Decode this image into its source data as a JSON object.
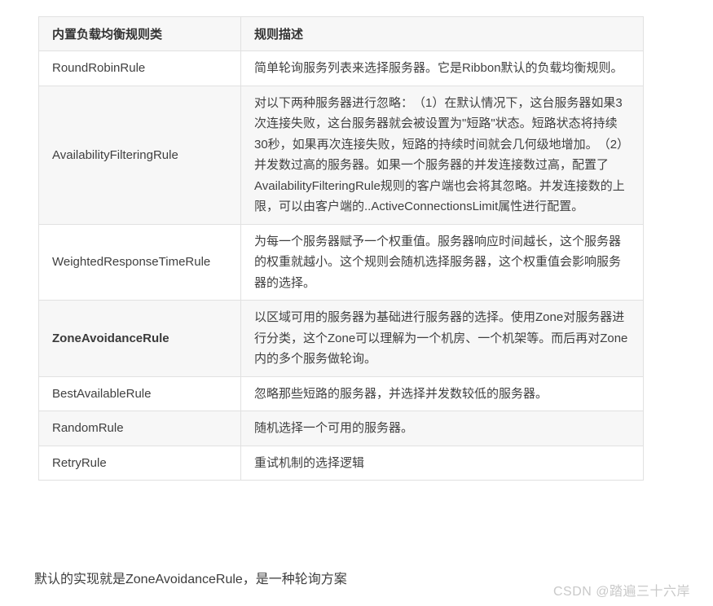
{
  "table": {
    "headers": {
      "rule_class": "内置负载均衡规则类",
      "description": "规则描述"
    },
    "rows": [
      {
        "rule": "RoundRobinRule",
        "desc": "简单轮询服务列表来选择服务器。它是Ribbon默认的负载均衡规则。"
      },
      {
        "rule": "AvailabilityFilteringRule",
        "desc": "对以下两种服务器进行忽略：　（1）在默认情况下，这台服务器如果3次连接失败，这台服务器就会被设置为\"短路\"状态。短路状态将持续30秒，如果再次连接失败，短路的持续时间就会几何级地增加。　（2）并发数过高的服务器。如果一个服务器的并发连接数过高，配置了AvailabilityFilteringRule规则的客户端也会将其忽略。并发连接数的上限，可以由客户端的..ActiveConnectionsLimit属性进行配置。"
      },
      {
        "rule": "WeightedResponseTimeRule",
        "desc": "为每一个服务器赋予一个权重值。服务器响应时间越长，这个服务器的权重就越小。这个规则会随机选择服务器，这个权重值会影响服务器的选择。"
      },
      {
        "rule": "ZoneAvoidanceRule",
        "desc": "以区域可用的服务器为基础进行服务器的选择。使用Zone对服务器进行分类，这个Zone可以理解为一个机房、一个机架等。而后再对Zone内的多个服务做轮询。"
      },
      {
        "rule": "BestAvailableRule",
        "desc": "忽略那些短路的服务器，并选择并发数较低的服务器。"
      },
      {
        "rule": "RandomRule",
        "desc": "随机选择一个可用的服务器。"
      },
      {
        "rule": "RetryRule",
        "desc": "重试机制的选择逻辑"
      }
    ]
  },
  "footer": {
    "note": "默认的实现就是ZoneAvoidanceRule，是一种轮询方案"
  },
  "watermark": {
    "text": "CSDN @踏遍三十六岸"
  },
  "colors": {
    "row_alt_bg": "#f7f7f7",
    "border": "#e1e1e1",
    "text": "#404040",
    "watermark": "#c9c9c9"
  }
}
